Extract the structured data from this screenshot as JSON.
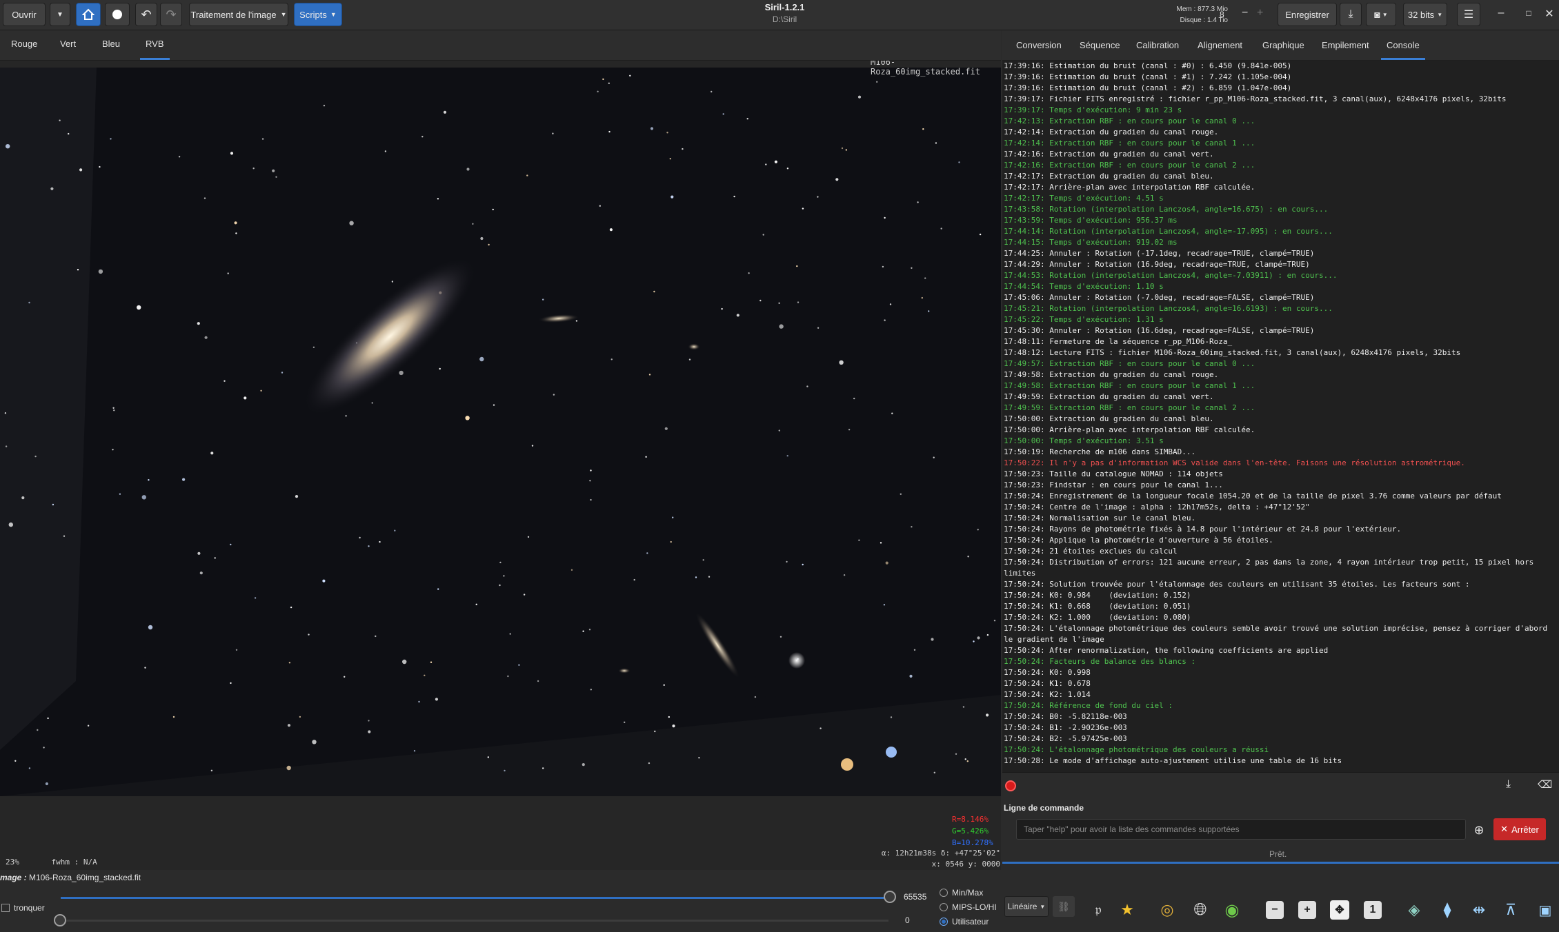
{
  "header": {
    "open_label": "Ouvrir",
    "image_processing_label": "Traitement de l'image",
    "scripts_label": "Scripts",
    "app_title": "Siril-1.2.1",
    "working_dir": "D:\\Siril",
    "mem_label": "Mem : 877.3 Mio",
    "disk_label": "Disque : 1.4 Tio",
    "threads_value": "8",
    "save_label": "Enregistrer",
    "bit_depth_label": "32 bits"
  },
  "channel_tabs": [
    {
      "label": "Rouge"
    },
    {
      "label": "Vert"
    },
    {
      "label": "Bleu"
    },
    {
      "label": "RVB",
      "active": true
    }
  ],
  "right_tabs": [
    {
      "label": "Conversion"
    },
    {
      "label": "Séquence"
    },
    {
      "label": "Calibration"
    },
    {
      "label": "Alignement"
    },
    {
      "label": "Graphique"
    },
    {
      "label": "Empilement"
    },
    {
      "label": "Console",
      "active": true
    }
  ],
  "image_view": {
    "filename": "M106-Roza_60img_stacked.fit",
    "readout_r": "R=8.146%",
    "readout_g": "G=5.426%",
    "readout_b": "B=10.278%",
    "zoom": "23%",
    "fwhm": "fwhm : N/A",
    "coord_radec": "α: 12h21m38s δ: +47°25'02\"",
    "coord_xy": "x: 0546 y: 0000",
    "colors": {
      "r": "#ff3030",
      "g": "#30d030",
      "b": "#3070ff"
    }
  },
  "console": {
    "lines": [
      {
        "text": "17:39:16: Estimation du bruit (canal : #0) : 6.450 (9.841e-005)",
        "c": "w"
      },
      {
        "text": "17:39:16: Estimation du bruit (canal : #1) : 7.242 (1.105e-004)",
        "c": "w"
      },
      {
        "text": "17:39:16: Estimation du bruit (canal : #2) : 6.859 (1.047e-004)",
        "c": "w"
      },
      {
        "text": "17:39:17: Fichier FITS enregistré : fichier r_pp_M106-Roza_stacked.fit, 3 canal(aux), 6248x4176 pixels, 32bits",
        "c": "w"
      },
      {
        "text": "17:39:17: Temps d'exécution: 9 min 23 s",
        "c": "g"
      },
      {
        "text": "17:42:13: Extraction RBF : en cours pour le canal 0 ...",
        "c": "g"
      },
      {
        "text": "17:42:14: Extraction du gradien du canal rouge.",
        "c": "w"
      },
      {
        "text": "17:42:14: Extraction RBF : en cours pour le canal 1 ...",
        "c": "g"
      },
      {
        "text": "17:42:16: Extraction du gradien du canal vert.",
        "c": "w"
      },
      {
        "text": "17:42:16: Extraction RBF : en cours pour le canal 2 ...",
        "c": "g"
      },
      {
        "text": "17:42:17: Extraction du gradien du canal bleu.",
        "c": "w"
      },
      {
        "text": "17:42:17: Arrière-plan avec interpolation RBF calculée.",
        "c": "w"
      },
      {
        "text": "17:42:17: Temps d'exécution: 4.51 s",
        "c": "g"
      },
      {
        "text": "17:43:58: Rotation (interpolation Lanczos4, angle=16.675) : en cours...",
        "c": "g"
      },
      {
        "text": "17:43:59: Temps d'exécution: 956.37 ms",
        "c": "g"
      },
      {
        "text": "17:44:14: Rotation (interpolation Lanczos4, angle=-17.095) : en cours...",
        "c": "g"
      },
      {
        "text": "17:44:15: Temps d'exécution: 919.02 ms",
        "c": "g"
      },
      {
        "text": "17:44:25: Annuler : Rotation (-17.1deg, recadrage=TRUE, clampé=TRUE)",
        "c": "w"
      },
      {
        "text": "17:44:29: Annuler : Rotation (16.9deg, recadrage=TRUE, clampé=TRUE)",
        "c": "w"
      },
      {
        "text": "17:44:53: Rotation (interpolation Lanczos4, angle=-7.03911) : en cours...",
        "c": "g"
      },
      {
        "text": "17:44:54: Temps d'exécution: 1.10 s",
        "c": "g"
      },
      {
        "text": "17:45:06: Annuler : Rotation (-7.0deg, recadrage=FALSE, clampé=TRUE)",
        "c": "w"
      },
      {
        "text": "17:45:21: Rotation (interpolation Lanczos4, angle=16.6193) : en cours...",
        "c": "g"
      },
      {
        "text": "17:45:22: Temps d'exécution: 1.31 s",
        "c": "g"
      },
      {
        "text": "17:45:30: Annuler : Rotation (16.6deg, recadrage=FALSE, clampé=TRUE)",
        "c": "w"
      },
      {
        "text": "17:48:11: Fermeture de la séquence r_pp_M106-Roza_",
        "c": "w"
      },
      {
        "text": "17:48:12: Lecture FITS : fichier M106-Roza_60img_stacked.fit, 3 canal(aux), 6248x4176 pixels, 32bits",
        "c": "w"
      },
      {
        "text": "17:49:57: Extraction RBF : en cours pour le canal 0 ...",
        "c": "g"
      },
      {
        "text": "17:49:58: Extraction du gradien du canal rouge.",
        "c": "w"
      },
      {
        "text": "17:49:58: Extraction RBF : en cours pour le canal 1 ...",
        "c": "g"
      },
      {
        "text": "17:49:59: Extraction du gradien du canal vert.",
        "c": "w"
      },
      {
        "text": "17:49:59: Extraction RBF : en cours pour le canal 2 ...",
        "c": "g"
      },
      {
        "text": "17:50:00: Extraction du gradien du canal bleu.",
        "c": "w"
      },
      {
        "text": "17:50:00: Arrière-plan avec interpolation RBF calculée.",
        "c": "w"
      },
      {
        "text": "17:50:00: Temps d'exécution: 3.51 s",
        "c": "g"
      },
      {
        "text": "17:50:19: Recherche de m106 dans SIMBAD...",
        "c": "w"
      },
      {
        "text": "17:50:22: Il n'y a pas d'information WCS valide dans l'en-tête. Faisons une résolution astrométrique.",
        "c": "r"
      },
      {
        "text": "17:50:23: Taille du catalogue NOMAD : 114 objets",
        "c": "w"
      },
      {
        "text": "17:50:23: Findstar : en cours pour le canal 1...",
        "c": "w"
      },
      {
        "text": "17:50:24: Enregistrement de la longueur focale 1054.20 et de la taille de pixel 3.76 comme valeurs par défaut",
        "c": "w"
      },
      {
        "text": "17:50:24: Centre de l'image : alpha : 12h17m52s, delta : +47°12'52\"",
        "c": "w"
      },
      {
        "text": "17:50:24: Normalisation sur le canal bleu.",
        "c": "w"
      },
      {
        "text": "17:50:24: Rayons de photométrie fixés à 14.8 pour l'intérieur et 24.8 pour l'extérieur.",
        "c": "w"
      },
      {
        "text": "17:50:24: Applique la photométrie d'ouverture à 56 étoiles.",
        "c": "w"
      },
      {
        "text": "17:50:24: 21 étoiles exclues du calcul",
        "c": "w"
      },
      {
        "text": "17:50:24: Distribution of errors: 121 aucune erreur, 2 pas dans la zone, 4 rayon intérieur trop petit, 15 pixel hors limites",
        "c": "w"
      },
      {
        "text": "17:50:24: Solution trouvée pour l'étalonnage des couleurs en utilisant 35 étoiles. Les facteurs sont :",
        "c": "w"
      },
      {
        "text": "17:50:24: K0: 0.984    (deviation: 0.152)",
        "c": "w"
      },
      {
        "text": "17:50:24: K1: 0.668    (deviation: 0.051)",
        "c": "w"
      },
      {
        "text": "17:50:24: K2: 1.000    (deviation: 0.080)",
        "c": "w"
      },
      {
        "text": "17:50:24: L'étalonnage photométrique des couleurs semble avoir trouvé une solution imprécise, pensez à corriger d'abord le gradient de l'image",
        "c": "w"
      },
      {
        "text": "17:50:24: After renormalization, the following coefficients are applied",
        "c": "w"
      },
      {
        "text": "17:50:24: Facteurs de balance des blancs :",
        "c": "g"
      },
      {
        "text": "17:50:24: K0: 0.998",
        "c": "w"
      },
      {
        "text": "17:50:24: K1: 0.678",
        "c": "w"
      },
      {
        "text": "17:50:24: K2: 1.014",
        "c": "w"
      },
      {
        "text": "17:50:24: Référence de fond du ciel :",
        "c": "g"
      },
      {
        "text": "17:50:24: B0: -5.82118e-003",
        "c": "w"
      },
      {
        "text": "17:50:24: B1: -2.90236e-003",
        "c": "w"
      },
      {
        "text": "17:50:24: B2: -5.97425e-003",
        "c": "w"
      },
      {
        "text": "17:50:24: L'étalonnage photométrique des couleurs a réussi",
        "c": "g"
      },
      {
        "text": "17:50:28: Le mode d'affichage auto-ajustement utilise une table de 16 bits",
        "c": "w"
      }
    ]
  },
  "command": {
    "label": "Ligne de commande",
    "placeholder": "Taper \"help\" pour avoir la liste des commandes supportées",
    "stop_label": "Arrêter",
    "status": "Prêt."
  },
  "bottom": {
    "image_label_prefix": "mage : ",
    "image_label_value": "M106-Roza_60img_stacked.fit",
    "truncate_label": "tronquer",
    "high_value": "65535",
    "low_value": "0",
    "mode_minmax": "Min/Max",
    "mode_mips": "MIPS-LO/HI",
    "mode_user": "Utilisateur",
    "display_mode": "Linéaire"
  }
}
